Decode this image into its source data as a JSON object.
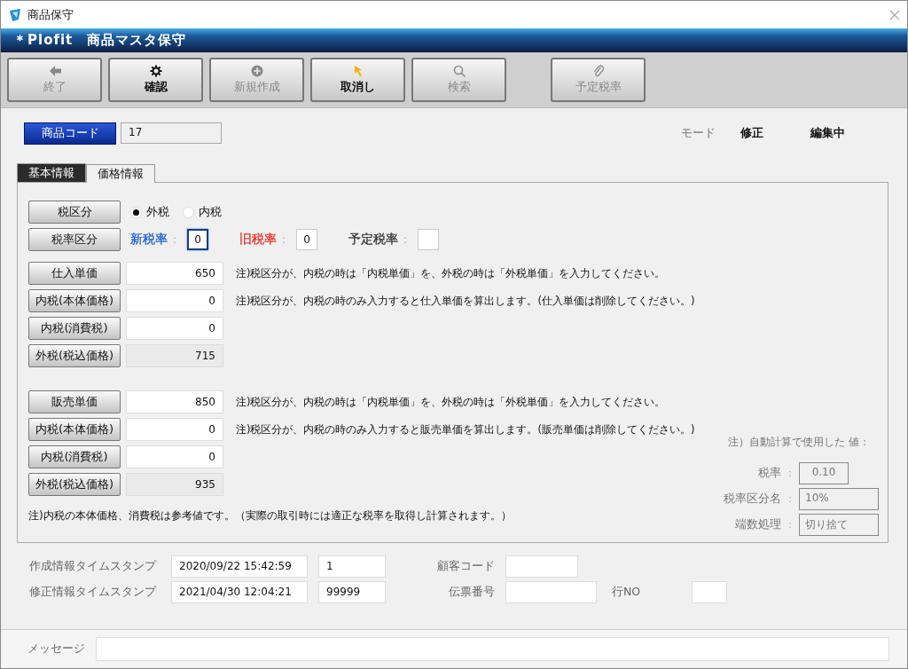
{
  "window": {
    "title": "商品保守"
  },
  "header": {
    "title": "＊Plofit　商品マスタ保守"
  },
  "toolbar": [
    {
      "label": "終了",
      "kind": "back",
      "disabled": true
    },
    {
      "label": "確認",
      "kind": "confirm",
      "disabled": false
    },
    {
      "label": "新規作成",
      "kind": "create",
      "disabled": true
    },
    {
      "label": "取消し",
      "kind": "undo",
      "disabled": false
    },
    {
      "label": "検索",
      "kind": "find",
      "disabled": true
    },
    {
      "label": "予定税率",
      "kind": "attach",
      "disabled": true
    }
  ],
  "product_code": {
    "label": "商品コード",
    "value": "17"
  },
  "mode": {
    "label": "モード",
    "value": "修正",
    "status": "編集中"
  },
  "tabs": [
    {
      "label": "基本情報",
      "selected": false
    },
    {
      "label": "価格情報",
      "selected": true
    }
  ],
  "tax_type": {
    "label": "税区分",
    "options": [
      {
        "label": "外税",
        "selected": true
      },
      {
        "label": "内税",
        "selected": false
      }
    ]
  },
  "tax_rate": {
    "label": "税率区分",
    "fields": [
      {
        "label": "新税率",
        "separator": ":",
        "value": "0",
        "color": "#1a5fd0",
        "focused": true
      },
      {
        "label": "旧税率",
        "separator": ":",
        "value": "0",
        "color": "#e8322a",
        "focused": false
      },
      {
        "label": "予定税率",
        "separator": ":",
        "color": "#333333",
        "focused": false
      }
    ]
  },
  "price_groups": [
    {
      "rows": [
        {
          "label": "仕入単価",
          "value": "650",
          "readonly": false,
          "note": "注)税区分が、内税の時は「内税単価」を、外税の時は「外税単価」を入力してください。"
        },
        {
          "label": "内税(本体価格)",
          "value": "0",
          "readonly": false,
          "note": "注)税区分が、内税の時のみ入力すると仕入単価を算出します。(仕入単価は削除してください。)"
        },
        {
          "label": "内税(消費税)",
          "value": "0",
          "readonly": false
        },
        {
          "label": "外税(税込価格)",
          "value": "715",
          "readonly": true
        }
      ]
    },
    {
      "rows": [
        {
          "label": "販売単価",
          "value": "850",
          "readonly": false,
          "note": "注)税区分が、内税の時は「内税単価」を、外税の時は「外税単価」を入力してください。"
        },
        {
          "label": "内税(本体価格)",
          "value": "0",
          "readonly": false,
          "note": "注)税区分が、内税の時のみ入力すると販売単価を算出します。(販売単価は削除してください。)"
        },
        {
          "label": "内税(消費税)",
          "value": "0",
          "readonly": false
        },
        {
          "label": "外税(税込価格)",
          "value": "935",
          "readonly": true
        }
      ]
    }
  ],
  "footnote": "注)内税の本体価格、消費税は参考値です。（実際の取引時には適正な税率を取得し計算されます。）",
  "auto_calc": {
    "heading": "注）自動計算で使用した 値：",
    "items": [
      {
        "label": "税率",
        "separator": "：",
        "value": "0.10"
      },
      {
        "label": "税率区分名",
        "separator": "：",
        "value": "10%"
      },
      {
        "label": "端数処理",
        "separator": "：",
        "value": "切り捨て"
      }
    ]
  },
  "timestamps": [
    {
      "label": "作成情報タイムスタンプ",
      "time": "2020/09/22 15:42:59",
      "number": "1"
    },
    {
      "label": "修正情報タイムスタンプ",
      "time": "2021/04/30 12:04:21",
      "number": "99999"
    }
  ],
  "customer_code": {
    "label": "顧客コード"
  },
  "slip": {
    "label": "伝票番号",
    "line_label": "行NO"
  },
  "message": {
    "label": "メッセージ"
  }
}
